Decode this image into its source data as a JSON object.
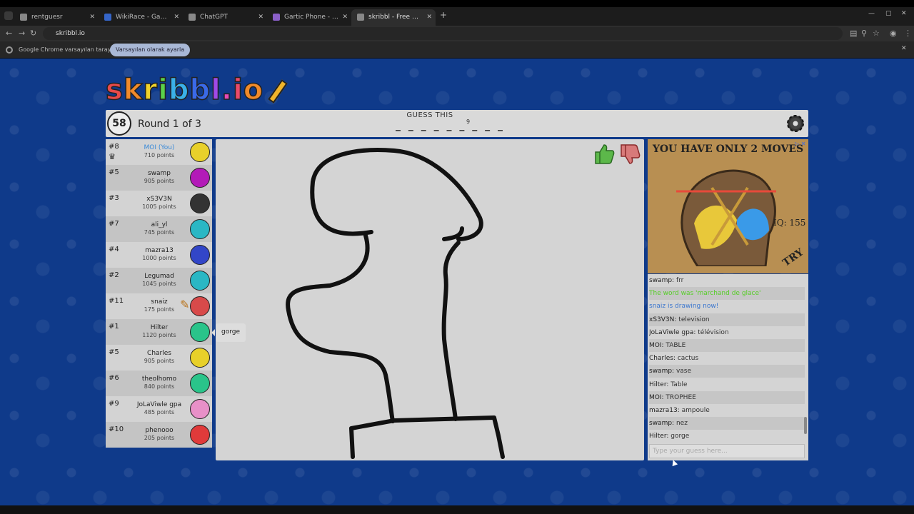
{
  "browser": {
    "tabs": [
      {
        "label": "rentguesr"
      },
      {
        "label": "WikiRace - Game"
      },
      {
        "label": "ChatGPT"
      },
      {
        "label": "Gartic Phone - Le jeu du téléphone"
      },
      {
        "label": "skribbl - Free Multiplayer Drawing"
      }
    ],
    "url": "skribbl.io",
    "infobar_text": "Google Chrome varsayılan tarayıcınız değil",
    "infobar_button": "Varsayılan olarak ayarla"
  },
  "game": {
    "logo_text": "skribbl.io",
    "timer": "58",
    "round_text": "Round 1 of 3",
    "guess_label": "GUESS THIS",
    "word_blanks": "_ _ _ _ _ _ _ _ _",
    "word_length": "9",
    "players": [
      {
        "rank": "#8",
        "name": "MOI (You)",
        "points": "710 points",
        "color": "#e8d02a"
      },
      {
        "rank": "#5",
        "name": "swamp",
        "points": "905 points",
        "color": "#b31ab8"
      },
      {
        "rank": "#3",
        "name": "xS3V3N",
        "points": "1005 points",
        "color": "#333333"
      },
      {
        "rank": "#7",
        "name": "ali_yl",
        "points": "745 points",
        "color": "#2ab7c4"
      },
      {
        "rank": "#4",
        "name": "mazra13",
        "points": "1000 points",
        "color": "#3246c8"
      },
      {
        "rank": "#2",
        "name": "Legumad",
        "points": "1045 points",
        "color": "#2ab7c4"
      },
      {
        "rank": "#11",
        "name": "snaiz",
        "points": "175 points",
        "color": "#d84a4a"
      },
      {
        "rank": "#1",
        "name": "Hilter",
        "points": "1120 points",
        "color": "#2ac48a"
      },
      {
        "rank": "#5",
        "name": "Charles",
        "points": "905 points",
        "color": "#e8d02a"
      },
      {
        "rank": "#6",
        "name": "theolhomo",
        "points": "840 points",
        "color": "#2ac48a"
      },
      {
        "rank": "#9",
        "name": "JoLaViwle gpa",
        "points": "485 points",
        "color": "#e890c8"
      },
      {
        "rank": "#10",
        "name": "phenooo",
        "points": "205 points",
        "color": "#e03a3a"
      }
    ],
    "guess_bubble": "gorge",
    "ad": {
      "title": "YOU HAVE ONLY 2 MOVES",
      "iq": "IQ: 155",
      "try": "TRY"
    },
    "chat": [
      {
        "name": "swamp:",
        "text": "frr",
        "type": "normal"
      },
      {
        "name": "",
        "text": "The word was 'marchand de glace'",
        "type": "green"
      },
      {
        "name": "",
        "text": "snaiz is drawing now!",
        "type": "blue"
      },
      {
        "name": "xS3V3N:",
        "text": "television",
        "type": "normal"
      },
      {
        "name": "JoLaViwle gpa:",
        "text": "télévision",
        "type": "normal"
      },
      {
        "name": "MOI:",
        "text": "TABLE",
        "type": "normal"
      },
      {
        "name": "Charles:",
        "text": "cactus",
        "type": "normal"
      },
      {
        "name": "swamp:",
        "text": "vase",
        "type": "normal"
      },
      {
        "name": "Hilter:",
        "text": "Table",
        "type": "normal"
      },
      {
        "name": "MOI:",
        "text": "TROPHEE",
        "type": "normal"
      },
      {
        "name": "mazra13:",
        "text": "ampoule",
        "type": "normal"
      },
      {
        "name": "swamp:",
        "text": "nez",
        "type": "normal"
      },
      {
        "name": "Hilter:",
        "text": "gorge",
        "type": "normal"
      }
    ],
    "chat_placeholder": "Type your guess here...",
    "colors": {
      "background": "#0f3a8a",
      "panel": "#d4d4d4",
      "green_msg": "#56ce27",
      "blue_msg": "#3975ce"
    }
  }
}
